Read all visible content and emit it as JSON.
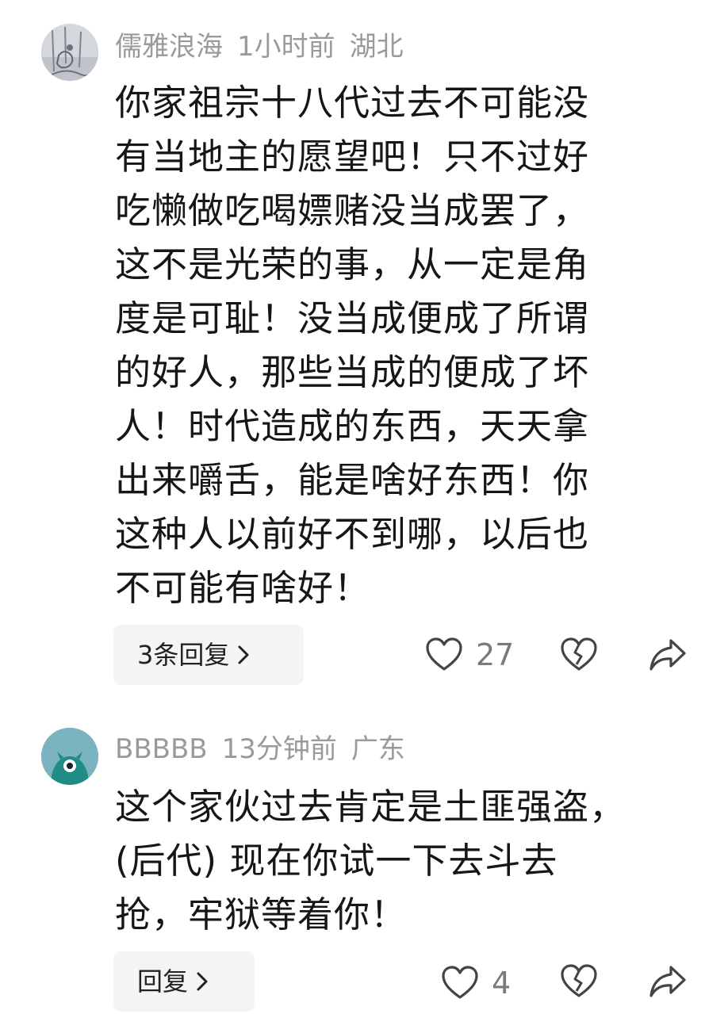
{
  "comments": [
    {
      "username": "儒雅浪海",
      "time": "1小时前",
      "location": "湖北",
      "avatar_icon": "sketch-avatar",
      "lines": [
        "你家祖宗十八代过去不可能没",
        "有当地主的愿望吧！只不过好",
        "吃懒做吃喝嫖赌没当成罢了，",
        "这不是光荣的事，从一定是角",
        "度是可耻！没当成便成了所谓",
        "的好人，那些当成的便成了坏",
        "人！时代造成的东西，天天拿",
        "出来嚼舌，能是啥好东西！你",
        "这种人以前好不到哪，以后也",
        "不可能有啥好！"
      ],
      "reply_label": "3条回复",
      "likes": "27"
    },
    {
      "username": "BBBBB",
      "time": "13分钟前",
      "location": "广东",
      "avatar_icon": "teal-monster-avatar",
      "lines": [
        "这个家伙过去肯定是土匪强盗，",
        "(后代) 现在你试一下去斗去",
        "抢，牢狱等着你！"
      ],
      "reply_label": "回复",
      "likes": "4"
    }
  ],
  "colors": {
    "meta_text": "#9a9a9a",
    "body_text": "#161616",
    "reply_bg": "#f4f4f4",
    "icon": "#444444",
    "avatar2_bg": "#6fa9b7",
    "avatar2_monster": "#1f8d85"
  }
}
